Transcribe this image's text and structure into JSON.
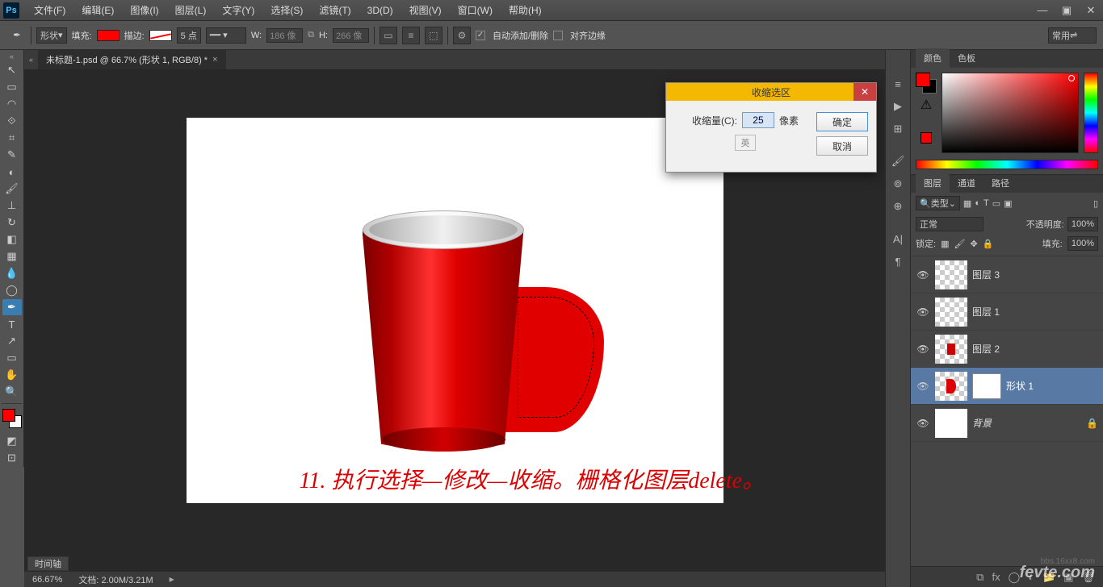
{
  "menubar": {
    "items": [
      "文件(F)",
      "编辑(E)",
      "图像(I)",
      "图层(L)",
      "文字(Y)",
      "选择(S)",
      "滤镜(T)",
      "3D(D)",
      "视图(V)",
      "窗口(W)",
      "帮助(H)"
    ]
  },
  "options": {
    "mode_label": "形状",
    "fill_label": "填充:",
    "stroke_label": "描边:",
    "stroke_pt": "5 点",
    "w_label": "W:",
    "w_val": "186 像",
    "h_label": "H:",
    "h_val": "266 像",
    "auto_label": "自动添加/删除",
    "align_label": "对齐边缘",
    "workspace": "常用"
  },
  "document": {
    "tab_title": "未标题-1.psd @ 66.7% (形状 1, RGB/8) *",
    "annotation": "11. 执行选择—修改—收缩。栅格化图层delete。"
  },
  "dialog": {
    "title": "收缩选区",
    "amount_label": "收缩量(C):",
    "amount_value": "25",
    "unit": "像素",
    "ime": "英",
    "ok": "确定",
    "cancel": "取消"
  },
  "panels": {
    "color_tab": "颜色",
    "swatches_tab": "色板",
    "warn": "⚠",
    "layers_tab": "图层",
    "channels_tab": "通道",
    "paths_tab": "路径",
    "kind_label": "类型",
    "blend_mode": "正常",
    "opacity_label": "不透明度:",
    "opacity_val": "100%",
    "lock_label": "锁定:",
    "fill_label": "填充:",
    "fill_val": "100%"
  },
  "layers": [
    {
      "name": "图层 3",
      "thumb": "transparent"
    },
    {
      "name": "图层 1",
      "thumb": "transparent"
    },
    {
      "name": "图层 2",
      "thumb": "cup"
    },
    {
      "name": "形状 1",
      "thumb": "handle",
      "selected": true,
      "mask": true
    },
    {
      "name": "背景",
      "thumb": "white",
      "locked": true,
      "italic": true
    }
  ],
  "status": {
    "zoom": "66.67%",
    "doc_label": "文档:",
    "doc_size": "2.00M/3.21M",
    "timeline": "时间轴"
  },
  "watermark": "fevte.com",
  "watermark2": "bbs.16xx8.com"
}
